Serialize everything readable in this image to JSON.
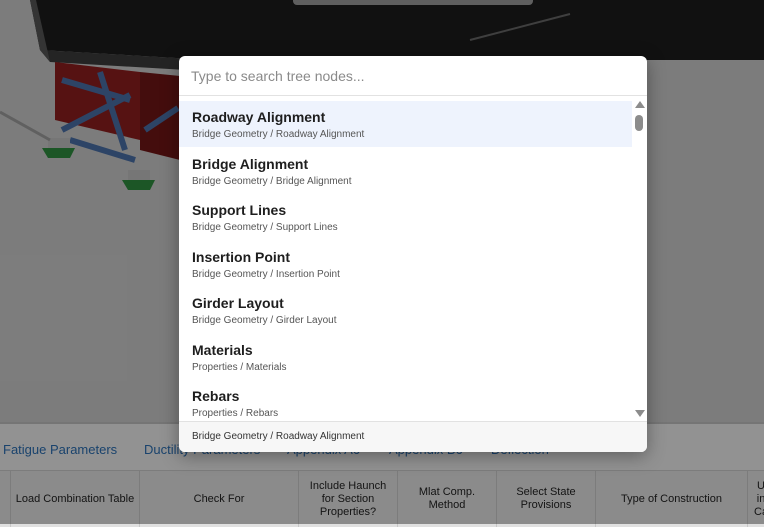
{
  "search": {
    "placeholder": "Type to search tree nodes...",
    "value": ""
  },
  "results": [
    {
      "title": "Roadway Alignment",
      "path": "Bridge Geometry / Roadway Alignment",
      "selected": true
    },
    {
      "title": "Bridge Alignment",
      "path": "Bridge Geometry / Bridge Alignment",
      "selected": false
    },
    {
      "title": "Support Lines",
      "path": "Bridge Geometry / Support Lines",
      "selected": false
    },
    {
      "title": "Insertion Point",
      "path": "Bridge Geometry / Insertion Point",
      "selected": false
    },
    {
      "title": "Girder Layout",
      "path": "Bridge Geometry / Girder Layout",
      "selected": false
    },
    {
      "title": "Materials",
      "path": "Properties / Materials",
      "selected": false
    },
    {
      "title": "Rebars",
      "path": "Properties / Rebars",
      "selected": false
    }
  ],
  "footer": {
    "selected_path": "Bridge Geometry / Roadway Alignment"
  },
  "bottom_panel": {
    "tabs": [
      "Fatigue Parameters",
      "Ductility Parameters",
      "Appendix A6",
      "Appendix B6",
      "Deflection"
    ],
    "table_headers": [
      "Load Combination Table",
      "Check For",
      "Include Haunch for Section Properties?",
      "Mlat Comp. Method",
      "Select State Provisions",
      "Type of Construction",
      "U in Ca"
    ]
  },
  "colors": {
    "tab_link": "#2a6db0",
    "selected_row": "#eef3fd",
    "girder_red": "#8b1e1e"
  }
}
